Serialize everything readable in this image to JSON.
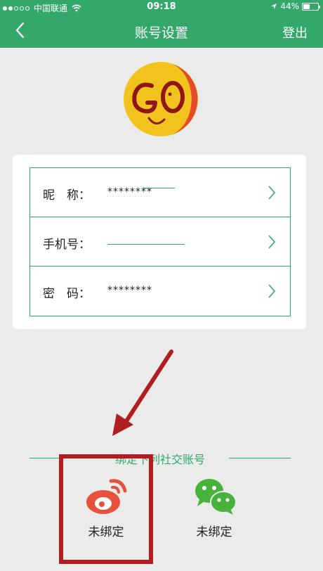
{
  "status_bar": {
    "carrier": "中国联通",
    "time": "09:18",
    "battery": "44%",
    "battery_level": 0.44
  },
  "nav": {
    "title": "账号设置",
    "logout_label": "登出"
  },
  "account_rows": [
    {
      "label": "昵　称：",
      "value": "********"
    },
    {
      "label": "手机号：",
      "value": ""
    },
    {
      "label": "密　码：",
      "value": "********"
    }
  ],
  "bind_section": {
    "title": "绑定下列社交账号"
  },
  "social": [
    {
      "icon": "weibo-icon",
      "status": "未绑定"
    },
    {
      "icon": "wechat-icon",
      "status": "未绑定"
    }
  ],
  "colors": {
    "accent": "#33a86a",
    "annotation": "#b01e22",
    "background": "#ebebeb"
  }
}
